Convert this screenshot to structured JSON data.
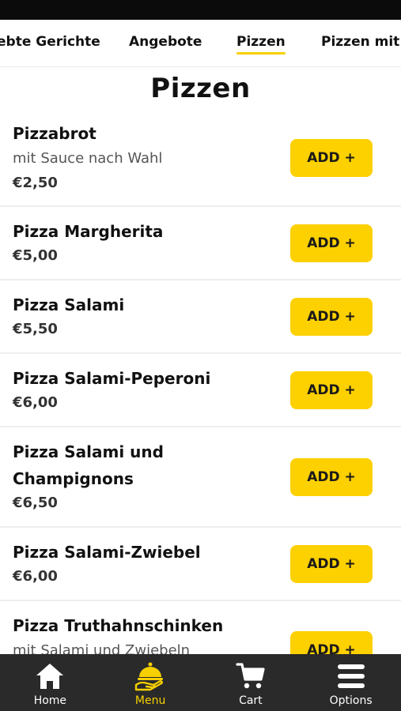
{
  "category_tabs": [
    {
      "label": "ebte Gerichte"
    },
    {
      "label": "Angebote"
    },
    {
      "label": "Pizzen"
    },
    {
      "label": "Pizzen mit"
    }
  ],
  "active_tab": "Pizzen",
  "section_title": "Pizzen",
  "items": [
    {
      "name": "Pizzabrot",
      "description": "mit Sauce nach Wahl",
      "price": "€2,50",
      "button": "ADD +"
    },
    {
      "name": "Pizza Margherita",
      "description": "",
      "price": "€5,00",
      "button": "ADD +"
    },
    {
      "name": "Pizza Salami",
      "description": "",
      "price": "€5,50",
      "button": "ADD +"
    },
    {
      "name": "Pizza Salami-Peperoni",
      "description": "",
      "price": "€6,00",
      "button": "ADD +"
    },
    {
      "name": "Pizza Salami und Champignons",
      "description": "",
      "price": "€6,50",
      "button": "ADD +"
    },
    {
      "name": "Pizza Salami-Zwiebel",
      "description": "",
      "price": "€6,00",
      "button": "ADD +"
    },
    {
      "name": "Pizza Truthahnschinken",
      "description": "mit Salami und Zwiebeln",
      "price": "",
      "button": "ADD +"
    }
  ],
  "bottom_nav": [
    {
      "label": "Home",
      "icon": "home-icon"
    },
    {
      "label": "Menu",
      "icon": "menu-service-icon",
      "active": true
    },
    {
      "label": "Cart",
      "icon": "cart-icon"
    },
    {
      "label": "Options",
      "icon": "options-icon"
    }
  ],
  "colors": {
    "accent": "#fdd000",
    "nav_bg": "#2a2a2a",
    "active_nav": "#f7d000"
  }
}
